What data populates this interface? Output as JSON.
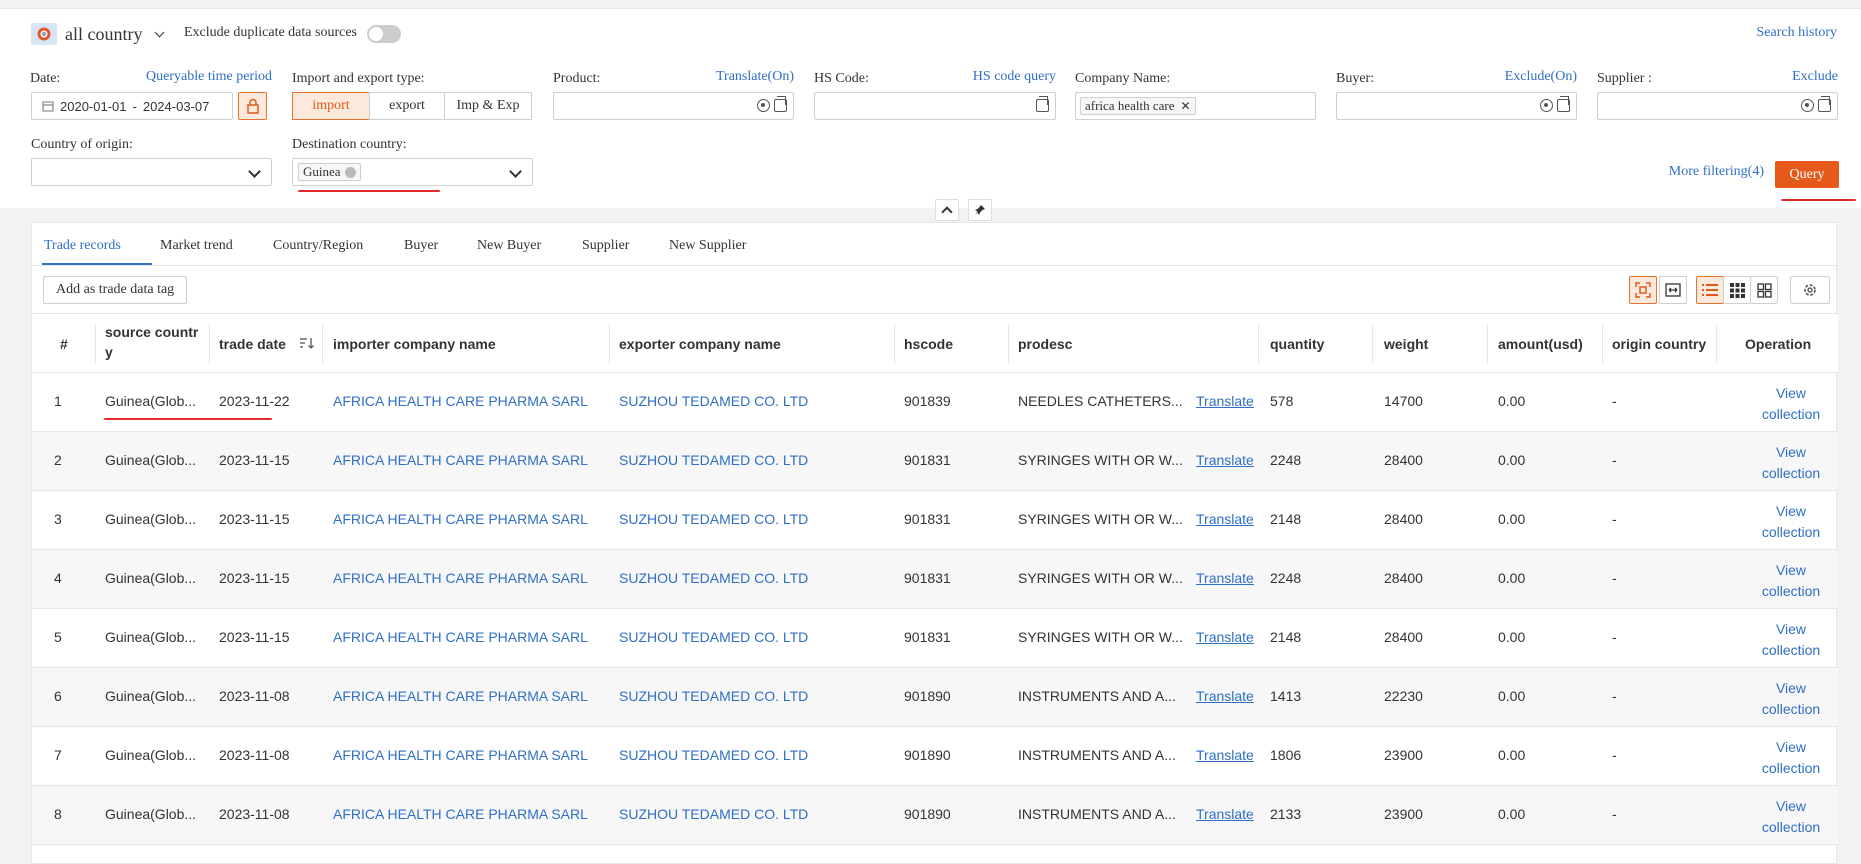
{
  "header": {
    "country_scope": "all country",
    "exclude_duplicate_label": "Exclude duplicate data sources",
    "search_history": "Search history"
  },
  "filters": {
    "date_label": "Date:",
    "date_link": "Queryable time period",
    "date_start": "2020-01-01",
    "date_sep": "-",
    "date_end": "2024-03-07",
    "trade_type_label": "Import and export type:",
    "trade_types": [
      "import",
      "export",
      "Imp & Exp"
    ],
    "trade_type_selected": "import",
    "product_label": "Product:",
    "product_link": "Translate(On)",
    "hs_label": "HS Code:",
    "hs_link": "HS code query",
    "company_label": "Company Name:",
    "company_tag": "africa health care",
    "buyer_label": "Buyer:",
    "buyer_link": "Exclude(On)",
    "supplier_label": "Supplier :",
    "supplier_link": "Exclude",
    "origin_label": "Country of origin:",
    "destination_label": "Destination country:",
    "destination_tag": "Guinea",
    "more_filtering": "More filtering(4)",
    "query_button": "Query"
  },
  "tabs": [
    "Trade records",
    "Market trend",
    "Country/Region",
    "Buyer",
    "New Buyer",
    "Supplier",
    "New Supplier"
  ],
  "active_tab": "Trade records",
  "add_tag_button": "Add as trade data tag",
  "table": {
    "columns": [
      "#",
      "source country",
      "trade date",
      "importer company name",
      "exporter company name",
      "hscode",
      "prodesc",
      "quantity",
      "weight",
      "amount(usd)",
      "origin country",
      "Operation"
    ],
    "source_col_line1": "source countr",
    "source_col_line2": "y",
    "translate_label": "Translate",
    "operation_line1": "View",
    "operation_line2": "collection",
    "rows": [
      {
        "n": "1",
        "source": "Guinea(Glob...",
        "date": "2023-11-22",
        "importer": "AFRICA HEALTH CARE PHARMA SARL",
        "exporter": "SUZHOU TEDAMED CO. LTD",
        "hscode": "901839",
        "prodesc": "NEEDLES CATHETERS...",
        "quantity": "578",
        "weight": "14700",
        "amount": "0.00",
        "origin": "-"
      },
      {
        "n": "2",
        "source": "Guinea(Glob...",
        "date": "2023-11-15",
        "importer": "AFRICA HEALTH CARE PHARMA SARL",
        "exporter": "SUZHOU TEDAMED CO. LTD",
        "hscode": "901831",
        "prodesc": "SYRINGES WITH OR W...",
        "quantity": "2248",
        "weight": "28400",
        "amount": "0.00",
        "origin": "-"
      },
      {
        "n": "3",
        "source": "Guinea(Glob...",
        "date": "2023-11-15",
        "importer": "AFRICA HEALTH CARE PHARMA SARL",
        "exporter": "SUZHOU TEDAMED CO. LTD",
        "hscode": "901831",
        "prodesc": "SYRINGES WITH OR W...",
        "quantity": "2148",
        "weight": "28400",
        "amount": "0.00",
        "origin": "-"
      },
      {
        "n": "4",
        "source": "Guinea(Glob...",
        "date": "2023-11-15",
        "importer": "AFRICA HEALTH CARE PHARMA SARL",
        "exporter": "SUZHOU TEDAMED CO. LTD",
        "hscode": "901831",
        "prodesc": "SYRINGES WITH OR W...",
        "quantity": "2248",
        "weight": "28400",
        "amount": "0.00",
        "origin": "-"
      },
      {
        "n": "5",
        "source": "Guinea(Glob...",
        "date": "2023-11-15",
        "importer": "AFRICA HEALTH CARE PHARMA SARL",
        "exporter": "SUZHOU TEDAMED CO. LTD",
        "hscode": "901831",
        "prodesc": "SYRINGES WITH OR W...",
        "quantity": "2148",
        "weight": "28400",
        "amount": "0.00",
        "origin": "-"
      },
      {
        "n": "6",
        "source": "Guinea(Glob...",
        "date": "2023-11-08",
        "importer": "AFRICA HEALTH CARE PHARMA SARL",
        "exporter": "SUZHOU TEDAMED CO. LTD",
        "hscode": "901890",
        "prodesc": "INSTRUMENTS AND A...",
        "quantity": "1413",
        "weight": "22230",
        "amount": "0.00",
        "origin": "-"
      },
      {
        "n": "7",
        "source": "Guinea(Glob...",
        "date": "2023-11-08",
        "importer": "AFRICA HEALTH CARE PHARMA SARL",
        "exporter": "SUZHOU TEDAMED CO. LTD",
        "hscode": "901890",
        "prodesc": "INSTRUMENTS AND A...",
        "quantity": "1806",
        "weight": "23900",
        "amount": "0.00",
        "origin": "-"
      },
      {
        "n": "8",
        "source": "Guinea(Glob...",
        "date": "2023-11-08",
        "importer": "AFRICA HEALTH CARE PHARMA SARL",
        "exporter": "SUZHOU TEDAMED CO. LTD",
        "hscode": "901890",
        "prodesc": "INSTRUMENTS AND A...",
        "quantity": "2133",
        "weight": "23900",
        "amount": "0.00",
        "origin": "-"
      }
    ]
  },
  "colors": {
    "accent": "#e55a1b",
    "link": "#2f6fc4",
    "annotation": "#e22b2b"
  }
}
